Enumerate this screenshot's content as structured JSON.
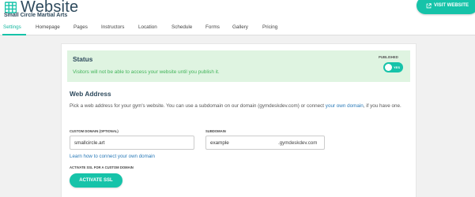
{
  "header": {
    "title": "Website",
    "subtitle": "Small Circle Martial Arts",
    "visit_button": "VISIT WEBSITE",
    "logo_icon": "grid-table-icon",
    "accent_color": "#16c3a9"
  },
  "tabs": [
    {
      "label": "Settings",
      "active": true
    },
    {
      "label": "Homepage"
    },
    {
      "label": "Pages"
    },
    {
      "label": "Instructors"
    },
    {
      "label": "Location"
    },
    {
      "label": "Schedule"
    },
    {
      "label": "Forms"
    },
    {
      "label": "Gallery"
    },
    {
      "label": "Pricing"
    }
  ],
  "status": {
    "title": "Status",
    "message": "Visitors will not be able to access your website until you publish it.",
    "published_label": "PUBLISHED",
    "toggle_text": "YES",
    "toggle_on": true
  },
  "web_address": {
    "title": "Web Address",
    "description_start": "Pick a web address for your gym's website. You can use a subdomain on our domain (gymdeskdev.com) or connect ",
    "description_link": "your own domain",
    "description_end": ", if you have one.",
    "custom_domain_label": "CUSTOM DOMAIN (OPTIONAL)",
    "custom_domain_value": "smallcircle.art",
    "subdomain_label": "SUBDOMAIN",
    "subdomain_value": "example",
    "subdomain_suffix": ".gymdeskdev.com",
    "learn_link": "Learn how to connect your own domain",
    "ssl_label": "ACTIVATE SSL FOR A CUSTOM DOMAIN",
    "ssl_button": "ACTIVATE SSL"
  }
}
